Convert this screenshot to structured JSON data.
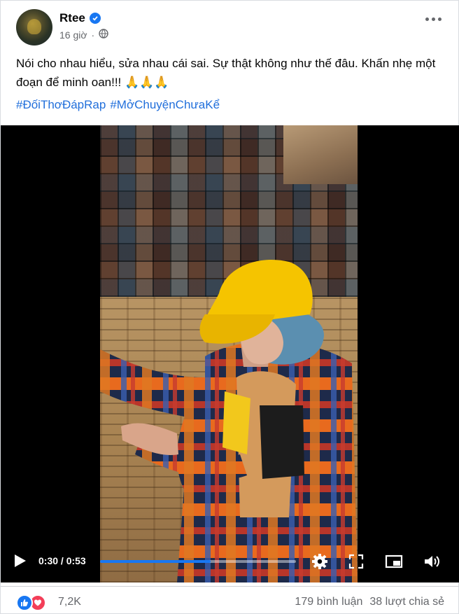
{
  "post": {
    "author": "Rtee",
    "time": "16 giờ",
    "caption": "Nói cho nhau hiểu, sửa nhau cái sai. Sự thật không như thế đâu. Khấn nhẹ một đoạn để minh oan!!! 🙏🙏🙏",
    "hashtags": [
      "#ĐốiThơĐápRap",
      "#MởChuyệnChưaKể"
    ]
  },
  "video": {
    "current_time": "0:30",
    "duration": "0:53",
    "time_label": "0:30 / 0:53",
    "progress_fraction": 0.566
  },
  "footer": {
    "reaction_count": "7,2K",
    "comments": "179 bình luận",
    "shares": "38 lượt chia sẻ"
  },
  "colors": {
    "accent": "#1877f2",
    "love": "#f33e58",
    "hashtag": "#216fdb",
    "muted": "#65676b"
  },
  "icons": [
    "verified-icon",
    "globe-icon",
    "more-icon",
    "play-icon",
    "settings-icon",
    "fullscreen-icon",
    "pip-icon",
    "volume-icon",
    "like-reaction-icon",
    "love-reaction-icon"
  ]
}
